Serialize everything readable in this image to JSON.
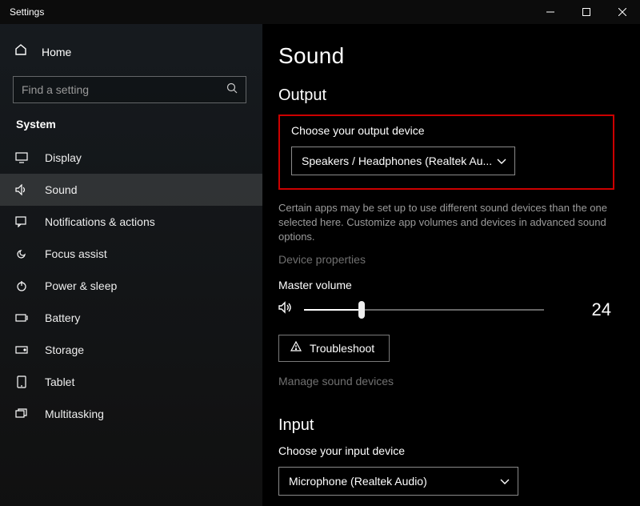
{
  "window": {
    "title": "Settings"
  },
  "sidebar": {
    "home": "Home",
    "search_placeholder": "Find a setting",
    "group": "System",
    "items": [
      {
        "label": "Display"
      },
      {
        "label": "Sound"
      },
      {
        "label": "Notifications & actions"
      },
      {
        "label": "Focus assist"
      },
      {
        "label": "Power & sleep"
      },
      {
        "label": "Battery"
      },
      {
        "label": "Storage"
      },
      {
        "label": "Tablet"
      },
      {
        "label": "Multitasking"
      }
    ]
  },
  "main": {
    "title": "Sound",
    "output": {
      "heading": "Output",
      "choose_label": "Choose your output device",
      "selected": "Speakers / Headphones (Realtek Au...",
      "helper": "Certain apps may be set up to use different sound devices than the one selected here. Customize app volumes and devices in advanced sound options.",
      "device_properties": "Device properties",
      "master_label": "Master volume",
      "volume": "24",
      "troubleshoot": "Troubleshoot",
      "manage": "Manage sound devices"
    },
    "input": {
      "heading": "Input",
      "choose_label": "Choose your input device",
      "selected": "Microphone (Realtek Audio)"
    }
  }
}
